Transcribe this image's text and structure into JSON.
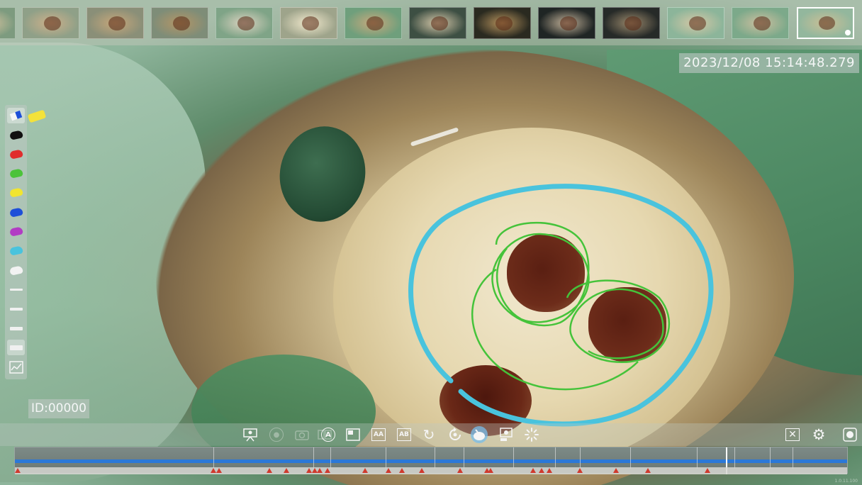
{
  "thumbnails": [
    {
      "tone": "#7d9b7f",
      "pulp": "#d9c5a0"
    },
    {
      "tone": "#8fa088",
      "pulp": "#cdb08a"
    },
    {
      "tone": "#8a8f78",
      "pulp": "#c7a77a"
    },
    {
      "tone": "#7e8d78",
      "pulp": "#b49566"
    },
    {
      "tone": "#7fa487",
      "pulp": "#dcd3c1"
    },
    {
      "tone": "#9ea48b",
      "pulp": "#f2e9cd"
    },
    {
      "tone": "#6f9f7c",
      "pulp": "#c9a97d"
    },
    {
      "tone": "#3d4f43",
      "pulp": "#d8c9aa"
    },
    {
      "tone": "#2a2a20",
      "pulp": "#b7935d"
    },
    {
      "tone": "#1f2524",
      "pulp": "#c4b39a"
    },
    {
      "tone": "#262a28",
      "pulp": "#9c8a6d"
    },
    {
      "tone": "#8cb59a",
      "pulp": "#d6c8a6"
    },
    {
      "tone": "#7ca98a",
      "pulp": "#cdbf9f"
    },
    {
      "tone": "#93b79d",
      "pulp": "#cbbf96"
    }
  ],
  "timestamp": "2023/12/08  15:14:48.279",
  "record_id": "ID:00000",
  "palette": {
    "active_color": "#f4e23a",
    "colors": [
      "#111111",
      "#e02d2d",
      "#4cc33a",
      "#f1e52f",
      "#1e4fd8",
      "#b23cc4",
      "#49c3dd",
      "#f2f2f2"
    ],
    "line_widths": [
      3,
      4,
      5,
      7
    ]
  },
  "toolbar": {
    "icons": [
      "presenter-icon",
      "record-icon",
      "camera-icon",
      "auto-icon",
      "picture-in-picture-icon",
      "compare-aa-icon",
      "compare-ab-icon",
      "rotate-icon",
      "replay-icon",
      "pen-mode-icon",
      "snapshot-icon",
      "loading-icon",
      "close-icon",
      "settings-icon",
      "stop-icon"
    ],
    "labels": {
      "auto": "A",
      "compare_a": "AA",
      "compare_b": "AB"
    }
  },
  "timeline": {
    "progress": 0.853,
    "segment_ticks": [
      0.238,
      0.358,
      0.378,
      0.445,
      0.503,
      0.538,
      0.598,
      0.648,
      0.678,
      0.738,
      0.818,
      0.863,
      0.906,
      0.933
    ],
    "bookmarks": [
      0.003,
      0.238,
      0.245,
      0.305,
      0.326,
      0.353,
      0.36,
      0.366,
      0.375,
      0.42,
      0.448,
      0.464,
      0.488,
      0.534,
      0.566,
      0.571,
      0.622,
      0.632,
      0.641,
      0.678,
      0.721,
      0.759,
      0.831
    ],
    "version": "1.0.11.100"
  },
  "colors": {
    "annotation_ring": "#49c3dd",
    "annotation_scribble": "#45c33a",
    "progress": "#2b78d8",
    "bookmark": "#d03a2e"
  }
}
